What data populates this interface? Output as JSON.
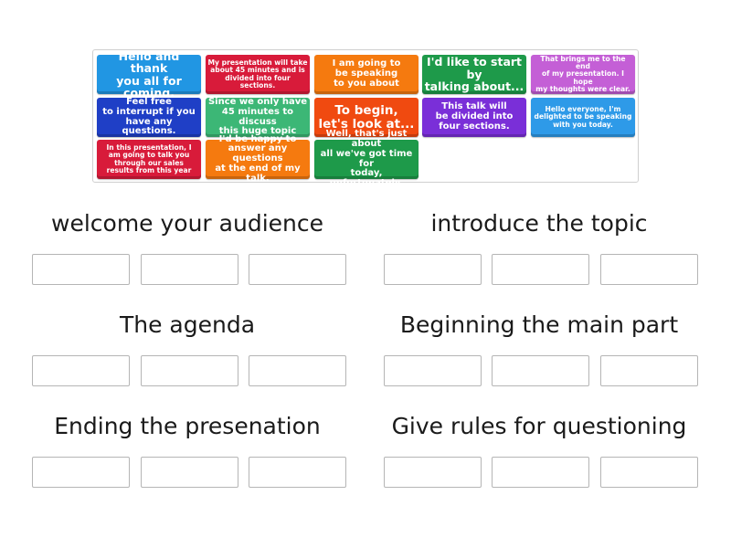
{
  "cards": [
    {
      "text": "Hello and thank\nyou all for coming.",
      "color": "#2196e3",
      "size": "lg"
    },
    {
      "text": "My presentation will take\nabout 45 minutes and is\ndivided into four sections.",
      "color": "#d81b3a",
      "size": "sm"
    },
    {
      "text": "I am going to\nbe speaking\nto you about",
      "color": "#f57a0f",
      "size": "md"
    },
    {
      "text": "I'd like to start by\ntalking about...",
      "color": "#1e9a4a",
      "size": "lg"
    },
    {
      "text": "That brings me to the end\nof my presentation. I hope\nmy thoughts were clear.",
      "color": "#c45fd6",
      "size": "sm"
    },
    {
      "text": "Feel free\nto interrupt if you\nhave any questions.",
      "color": "#1f3fc6",
      "size": "md"
    },
    {
      "text": "Since we only have\n45 minutes to discuss\nthis huge topic",
      "color": "#3cb776",
      "size": "md"
    },
    {
      "text": "To begin,\nlet's look at...",
      "color": "#f04a10",
      "size": "xl"
    },
    {
      "text": "This talk will\nbe divided into\nfour sections.",
      "color": "#7a2fd8",
      "size": "md"
    },
    {
      "text": "Hello everyone, I'm\ndelighted to be speaking\nwith you today.",
      "color": "#2e9ae8",
      "size": "sm"
    },
    {
      "text": "In this presentation, I\nam going to talk you\nthrough our sales\nresults from this year",
      "color": "#d81b3a",
      "size": "sm"
    },
    {
      "text": "I'd be happy to\nanswer any questions\nat the end of my talk.",
      "color": "#f57a0f",
      "size": "md"
    },
    {
      "text": "Well, that's just about\nall we've got time for\ntoday, unfortunately.",
      "color": "#1e9a4a",
      "size": "md"
    }
  ],
  "groups": [
    {
      "title": "welcome your audience"
    },
    {
      "title": "introduce the topic"
    },
    {
      "title": "The agenda"
    },
    {
      "title": "Beginning the main part"
    },
    {
      "title": "Ending the presenation"
    },
    {
      "title": "Give rules for questioning"
    }
  ]
}
